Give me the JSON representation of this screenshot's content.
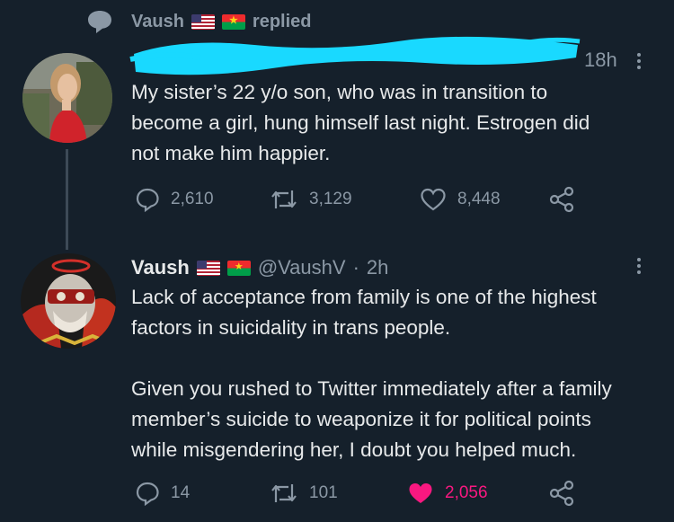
{
  "reply_header": {
    "name": "Vaush",
    "action": "replied"
  },
  "tweet1": {
    "time": "18h",
    "text_lines": [
      "My sister’s 22 y/o son, who was in transition to",
      "become a girl, hung himself last night. Estrogen did",
      "not make him happier."
    ],
    "replies": "2,610",
    "retweets": "3,129",
    "likes": "8,448"
  },
  "tweet2": {
    "author_name": "Vaush",
    "handle": "@VaushV",
    "separator": "·",
    "time": "2h",
    "text_lines": [
      "Lack of acceptance from family is one of the highest",
      "factors in suicidality in trans people.",
      "",
      "Given you rushed to Twitter immediately after a family",
      "member’s suicide to weaponize it for political points",
      "while misgendering her, I doubt you helped much."
    ],
    "replies": "14",
    "retweets": "101",
    "likes": "2,056",
    "liked": true
  },
  "colors": {
    "background": "#15202b",
    "text": "#e7e9ea",
    "muted": "#8b98a5",
    "like_active": "#f91880",
    "redaction": "#19d9ff"
  }
}
